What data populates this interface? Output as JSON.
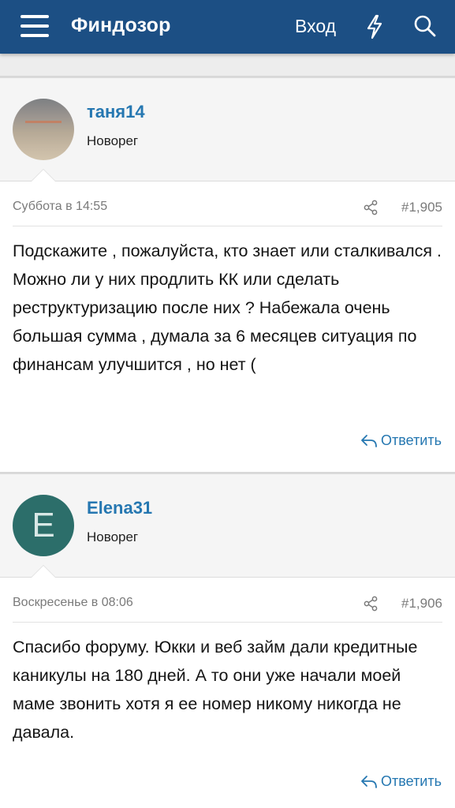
{
  "header": {
    "brand": "Финдозор",
    "login_label": "Вход",
    "icons": [
      "menu-icon",
      "bolt-icon",
      "search-icon"
    ],
    "background": "#1c4f84"
  },
  "posts": [
    {
      "username": "таня14",
      "user_title": "Новорег",
      "avatar": "photo",
      "date": "Суббота в 14:55",
      "post_number": "#1,905",
      "body": "Подскажите , пожалуйста, кто знает или сталкивался . Можно ли у них продлить КК или сделать реструктуризацию после них ? Набежала очень большая сумма , думала за 6 месяцев ситуация по финансам улучшится , но нет (",
      "reply_label": "Ответить"
    },
    {
      "username": "Elena31",
      "user_title": "Новорег",
      "avatar_letter": "E",
      "date": "Воскресенье в 08:06",
      "post_number": "#1,906",
      "body": "Спасибо форуму. Юкки и веб займ дали кредитные каникулы на 180 дней. А то они уже начали моей маме звонить хотя я ее номер никому никогда не давала.",
      "reply_label": "Ответить"
    }
  ],
  "colors": {
    "link": "#2577b1",
    "avatar_letter_bg": "#2c6e6a"
  }
}
